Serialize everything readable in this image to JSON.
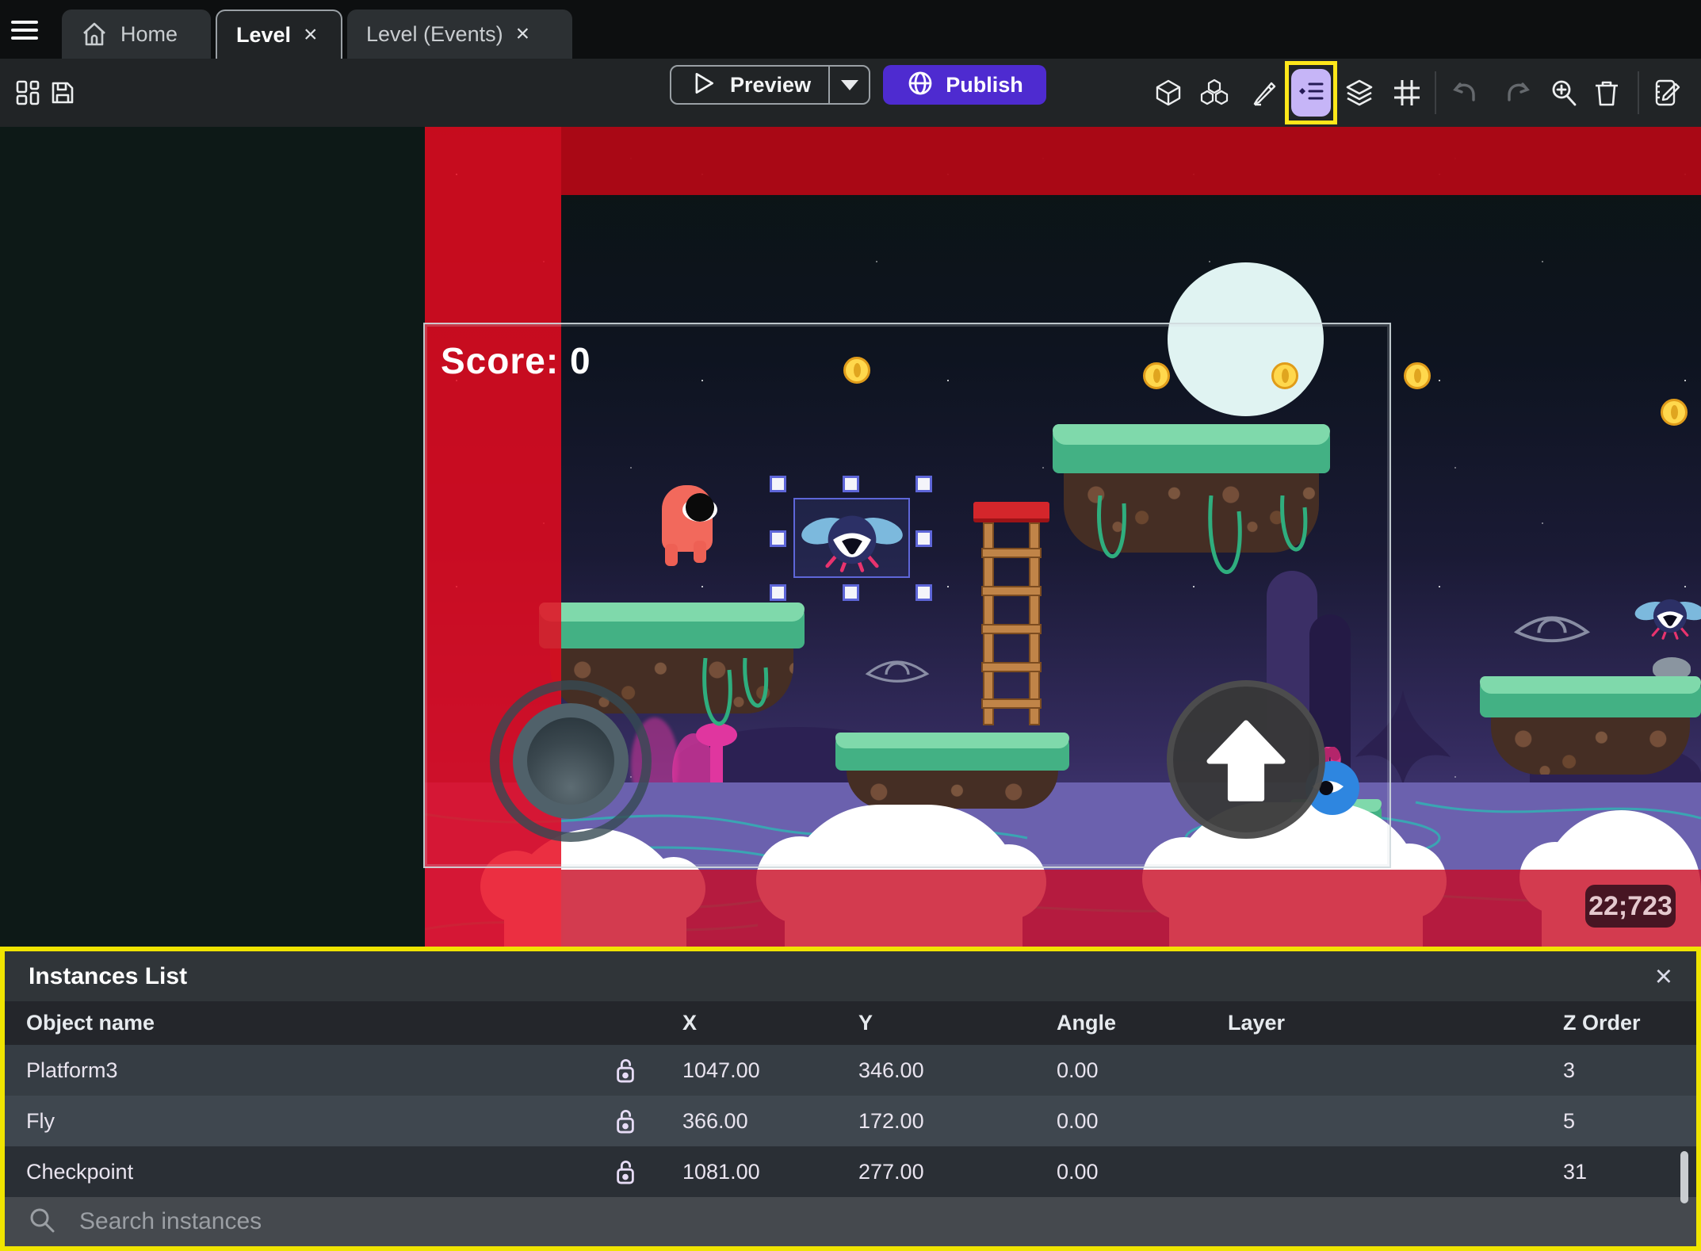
{
  "tabs": {
    "home": "Home",
    "level": "Level",
    "level_events": "Level (Events)",
    "close_glyph": "×"
  },
  "toolbar": {
    "preview": "Preview",
    "publish": "Publish"
  },
  "scene": {
    "score": "Score: 0",
    "coords_badge": "22;723"
  },
  "panel": {
    "title": "Instances List",
    "close_glyph": "×",
    "columns": [
      "Object name",
      "X",
      "Y",
      "Angle",
      "Layer",
      "Z Order"
    ],
    "rows": [
      {
        "name": "Platform3",
        "x": "1047.00",
        "y": "346.00",
        "angle": "0.00",
        "layer": "",
        "z": "3"
      },
      {
        "name": "Fly",
        "x": "366.00",
        "y": "172.00",
        "angle": "0.00",
        "layer": "",
        "z": "5"
      },
      {
        "name": "Checkpoint",
        "x": "1081.00",
        "y": "277.00",
        "angle": "0.00",
        "layer": "",
        "z": "31"
      }
    ],
    "search_placeholder": "Search instances"
  },
  "colors": {
    "publish_purple": "#4e2bd0",
    "highlight_yellow": "#ffe71a",
    "panel_border_yellow": "#f0e400",
    "selection_blue": "#5e66d8",
    "instances_button_bg": "#c6b5f7",
    "red_zone": "#e60e20"
  }
}
